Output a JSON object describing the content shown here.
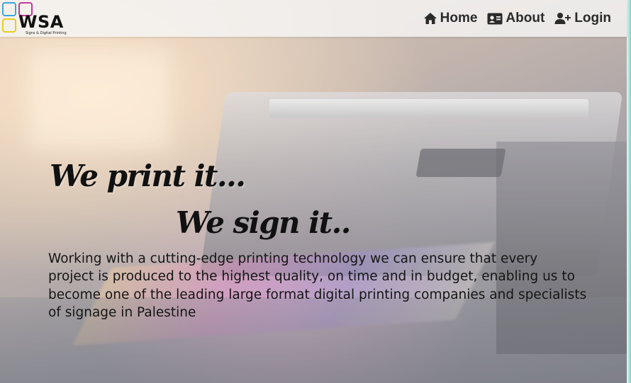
{
  "brand": {
    "name": "WSA",
    "tagline": "Signs & Digital Printing",
    "colors": [
      "#3aa7d9",
      "#c1399b",
      "#f3e02f",
      "#7b3fa0"
    ]
  },
  "nav": {
    "items": [
      {
        "label": "Home",
        "icon": "home-icon"
      },
      {
        "label": "About",
        "icon": "id-card-icon"
      },
      {
        "label": "Login",
        "icon": "user-plus-icon"
      }
    ]
  },
  "hero": {
    "line1": "We print it...",
    "line2": "We sign it..",
    "description": "Working with a cutting-edge printing technology we can ensure that every project is produced to the highest quality, on time and in budget, enabling us to become one of the leading large format digital printing companies and specialists of signage in Palestine"
  }
}
